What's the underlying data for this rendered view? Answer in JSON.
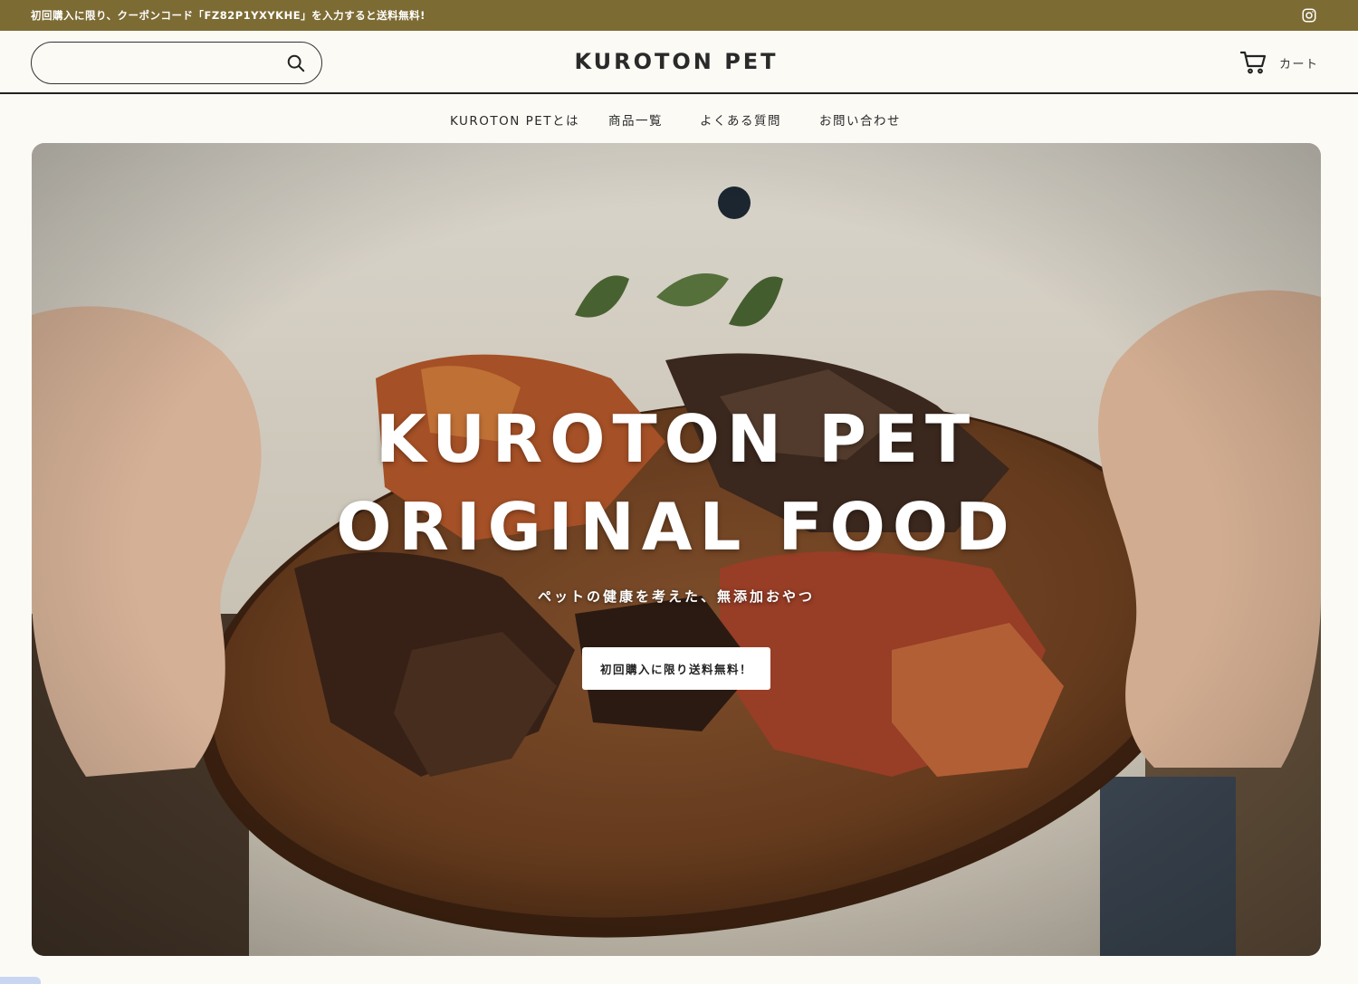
{
  "announcement": {
    "text": "初回購入に限り、クーポンコード「FZ82P1YXYKHE」を入力すると送料無料!",
    "social_icon": "instagram-icon"
  },
  "header": {
    "search": {
      "placeholder": "",
      "value": "",
      "icon": "search-icon"
    },
    "logo": "KUROTON PET",
    "cart": {
      "icon": "cart-icon",
      "label": "カート"
    }
  },
  "nav": {
    "items": [
      {
        "label": "KUROTON PETとは"
      },
      {
        "label": "商品一覧"
      },
      {
        "label": "よくある質問"
      },
      {
        "label": "お問い合わせ"
      }
    ]
  },
  "hero": {
    "title_line1": "KUROTON PET",
    "title_line2": "ORIGINAL FOOD",
    "subtitle": "ペットの健康を考えた、無添加おやつ",
    "cta_label": "初回購入に限り送料無料！"
  },
  "colors": {
    "announcement_bg": "#7d6b34",
    "page_bg": "#fbfaf5",
    "text": "#222222"
  }
}
